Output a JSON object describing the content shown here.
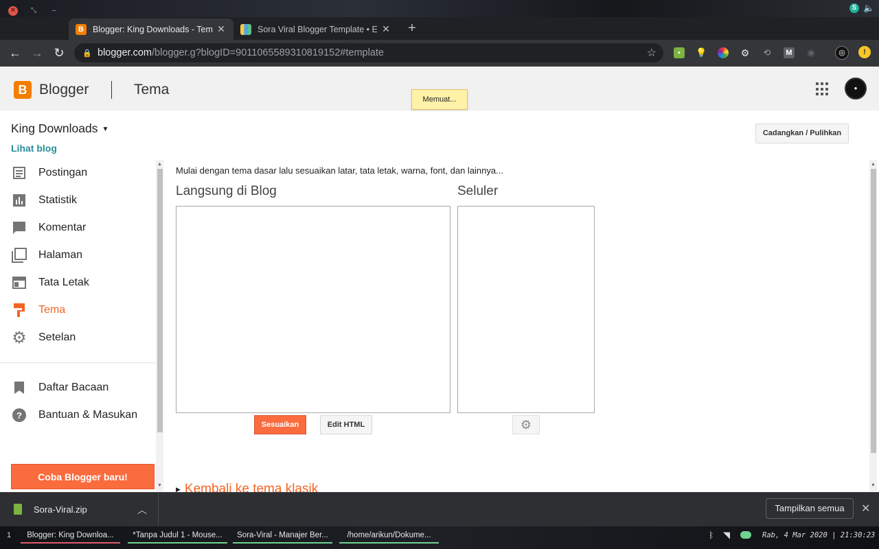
{
  "browser": {
    "tabs": [
      {
        "title": "Blogger: King Downloads - Tem",
        "active": true
      },
      {
        "title": "Sora Viral Blogger Template • E",
        "active": false
      }
    ],
    "new_tab_label": "+",
    "url_host": "blogger.com",
    "url_path": "/blogger.g?blogID=9011065589310819152#template"
  },
  "header": {
    "app_name": "Blogger",
    "section": "Tema",
    "loading_text": "Memuat..."
  },
  "sidebar": {
    "blog_name": "King Downloads",
    "view_blog": "Lihat blog",
    "items": [
      {
        "label": "Postingan",
        "icon": "posts-icon"
      },
      {
        "label": "Statistik",
        "icon": "stats-icon"
      },
      {
        "label": "Komentar",
        "icon": "comments-icon"
      },
      {
        "label": "Halaman",
        "icon": "pages-icon"
      },
      {
        "label": "Tata Letak",
        "icon": "layout-icon"
      },
      {
        "label": "Tema",
        "icon": "theme-icon",
        "active": true
      },
      {
        "label": "Setelan",
        "icon": "settings-icon"
      }
    ],
    "secondary_items": [
      {
        "label": "Daftar Bacaan",
        "icon": "bookmark-icon"
      },
      {
        "label": "Bantuan & Masukan",
        "icon": "help-icon"
      }
    ],
    "try_button": "Coba Blogger baru!"
  },
  "main": {
    "backup_button": "Cadangkan / Pulihkan",
    "intro": "Mulai dengan tema dasar lalu sesuaikan latar, tata letak, warna, font, dan lainnya...",
    "live_title": "Langsung di Blog",
    "mobile_title": "Seluler",
    "customize_button": "Sesuaikan",
    "edit_html_button": "Edit HTML",
    "classic_link": "Kembali ke tema klasik"
  },
  "downloads": {
    "file_name": "Sora-Viral.zip",
    "show_all": "Tampilkan semua"
  },
  "taskbar": {
    "workspace": "1",
    "tasks": [
      {
        "label": "Blogger: King Downloa...",
        "color": "#e05b6b"
      },
      {
        "label": "*Tanpa Judul 1 - Mouse...",
        "color": "#6fd38f"
      },
      {
        "label": "Sora-Viral - Manajer Ber...",
        "color": "#6fd38f"
      },
      {
        "label": "/home/arikun/Dokume...",
        "color": "#6fd38f"
      }
    ],
    "clock": "Rab,  4 Mar 2020 | 21:30:23"
  },
  "colors": {
    "accent": "#f26424",
    "link": "#268e9b",
    "blogger_orange": "#f57d00"
  }
}
